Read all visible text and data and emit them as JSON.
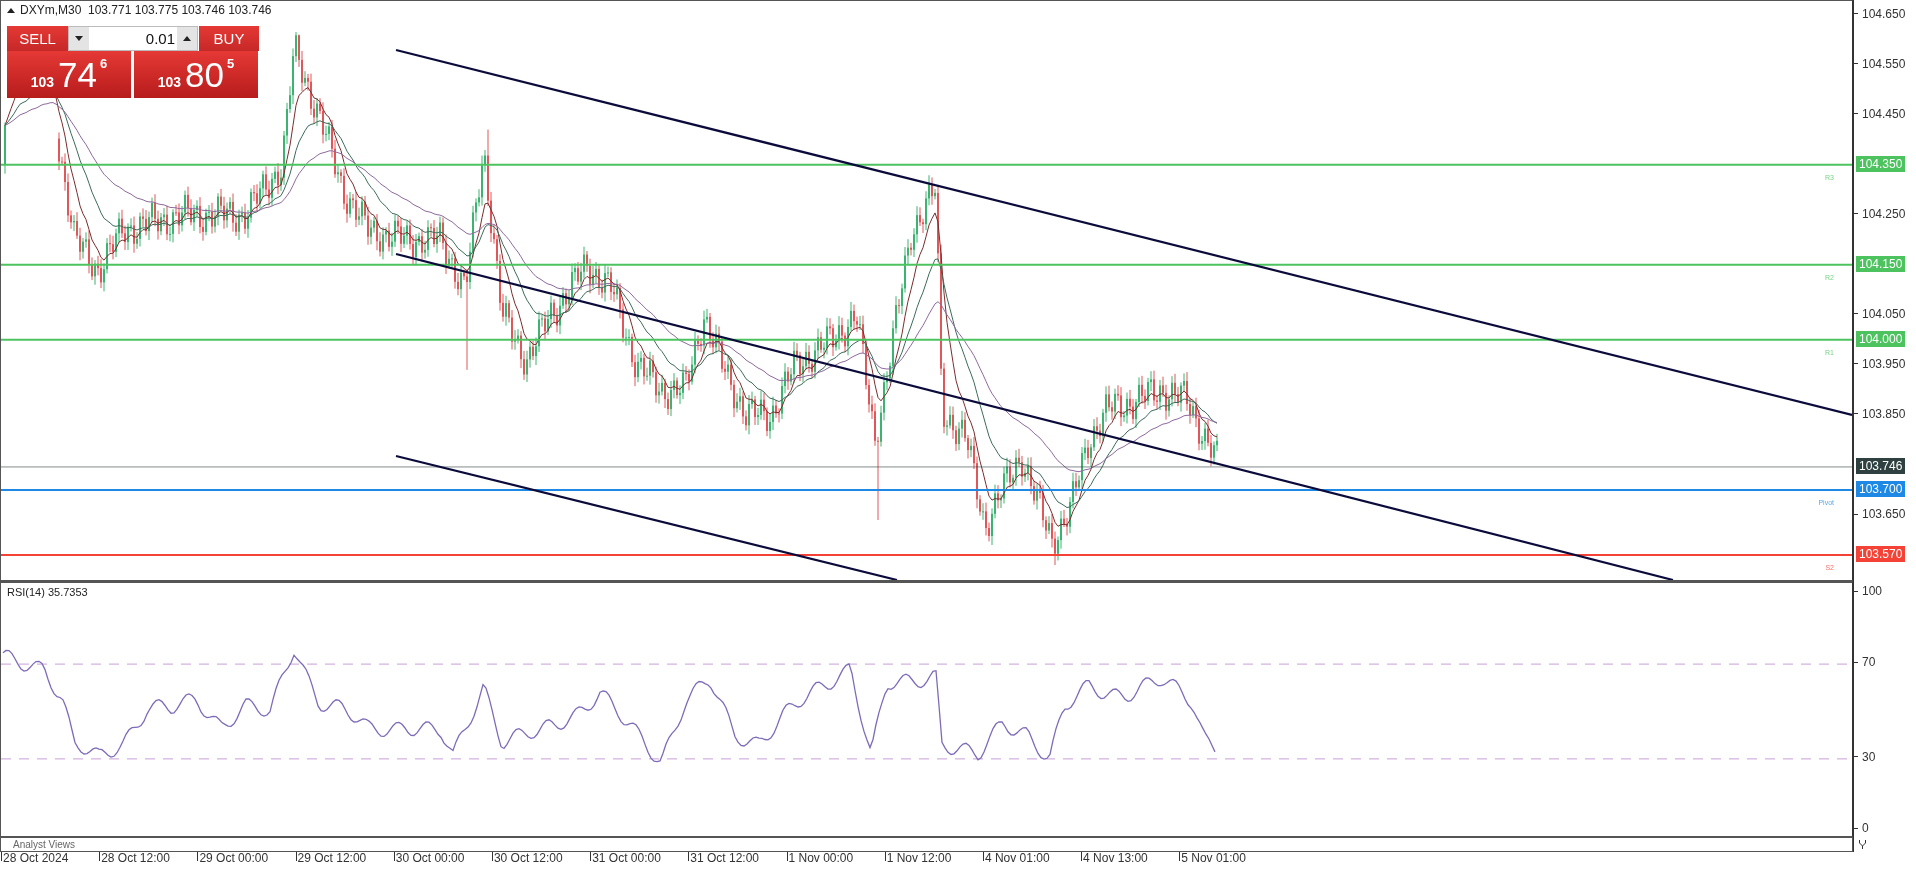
{
  "header": {
    "text": "DXYm,M30  103.771 103.775 103.746 103.746"
  },
  "trade_panel": {
    "sell_label": "SELL",
    "buy_label": "BUY",
    "volume": "0.01",
    "sell_price": {
      "big": "103",
      "main": "74",
      "sup": "6"
    },
    "buy_price": {
      "big": "103",
      "main": "80",
      "sup": "5"
    }
  },
  "price_axis": [
    "104.650",
    "104.550",
    "104.450",
    "104.250",
    "104.050",
    "103.950",
    "103.850",
    "103.650"
  ],
  "levels": [
    {
      "label": "104.350",
      "tag": "R3",
      "color": "#4cc35f"
    },
    {
      "label": "104.150",
      "tag": "R2",
      "color": "#4cc35f"
    },
    {
      "label": "104.000",
      "tag": "R1",
      "color": "#4cc35f"
    },
    {
      "label": "103.746",
      "color": "#2f4040"
    },
    {
      "label": "103.700",
      "tag": "Pivot",
      "color": "#1e88e5"
    },
    {
      "label": "103.570",
      "tag": "S2",
      "color": "#f44336"
    }
  ],
  "rsi": {
    "title": "RSI(14) 35.7353",
    "axis": [
      "100",
      "70",
      "30",
      "0"
    ]
  },
  "footer": {
    "text": "Analyst Views"
  },
  "time_axis": [
    "28 Oct 2024",
    "28 Oct 12:00",
    "29 Oct 00:00",
    "29 Oct 12:00",
    "30 Oct 00:00",
    "30 Oct 12:00",
    "31 Oct 00:00",
    "31 Oct 12:00",
    "1 Nov 00:00",
    "1 Nov 12:00",
    "4 Nov 01:00",
    "4 Nov 13:00",
    "5 Nov 01:00"
  ]
}
